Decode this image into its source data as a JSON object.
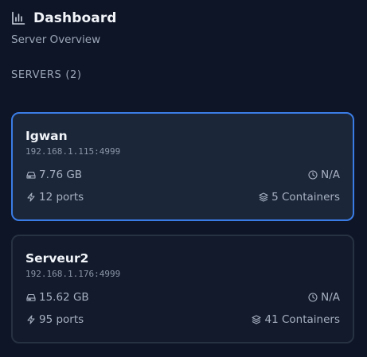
{
  "header": {
    "title": "Dashboard",
    "subtitle": "Server Overview",
    "logo_icon": "bar-chart-icon"
  },
  "section": {
    "label": "SERVERS",
    "count": "(2)"
  },
  "servers": [
    {
      "name": "Igwan",
      "address": "192.168.1.115:4999",
      "storage": "7.76 GB",
      "uptime": "N/A",
      "ports": "12 ports",
      "containers": "5 Containers",
      "selected": true
    },
    {
      "name": "Serveur2",
      "address": "192.168.1.176:4999",
      "storage": "15.62 GB",
      "uptime": "N/A",
      "ports": "95 ports",
      "containers": "41 Containers",
      "selected": false
    }
  ],
  "colors": {
    "background": "#0e1526",
    "card": "#121a2b",
    "card_selected": "#1b2638",
    "accent": "#3a7ce6",
    "border": "#263142"
  }
}
